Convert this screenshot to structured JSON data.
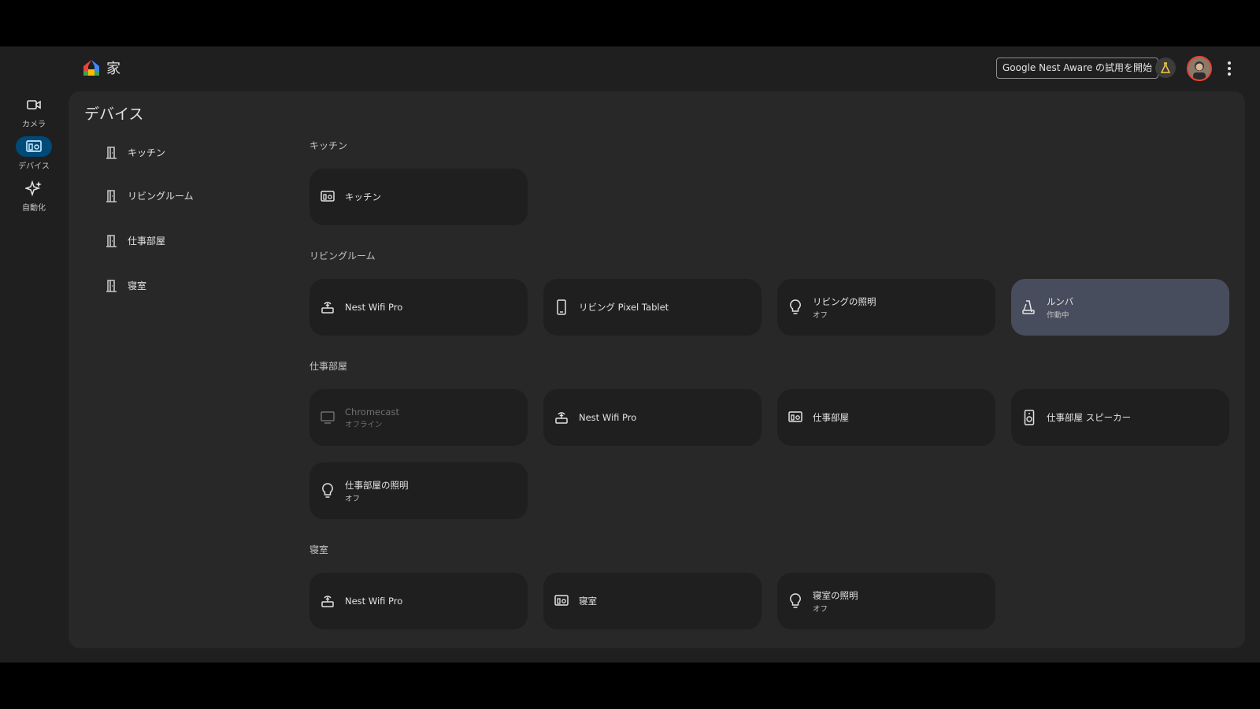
{
  "app": {
    "title": "家"
  },
  "topbar": {
    "nest_aware_label": "Google Nest Aware の試用を開始"
  },
  "rail": [
    {
      "label": "カメラ",
      "icon": "camera-icon"
    },
    {
      "label": "デバイス",
      "icon": "devices-icon",
      "active": true
    },
    {
      "label": "自動化",
      "icon": "automation-sparkle-icon"
    }
  ],
  "page": {
    "title": "デバイス"
  },
  "room_nav": [
    {
      "label": "キッチン"
    },
    {
      "label": "リビングルーム"
    },
    {
      "label": "仕事部屋"
    },
    {
      "label": "寝室"
    }
  ],
  "sections": [
    {
      "heading": "キッチン",
      "tiles": [
        {
          "name": "キッチン",
          "icon": "speaker-group-icon"
        }
      ]
    },
    {
      "heading": "リビングルーム",
      "tiles": [
        {
          "name": "Nest Wifi Pro",
          "icon": "router-icon"
        },
        {
          "name": "リビング Pixel Tablet",
          "icon": "tablet-icon"
        },
        {
          "name": "リビングの照明",
          "status": "オフ",
          "icon": "lightbulb-icon"
        },
        {
          "name": "ルンバ",
          "status": "作動中",
          "icon": "vacuum-icon",
          "active": true
        }
      ]
    },
    {
      "heading": "仕事部屋",
      "tiles": [
        {
          "name": "Chromecast",
          "status": "オフライン",
          "icon": "tv-icon",
          "offline": true
        },
        {
          "name": "Nest Wifi Pro",
          "icon": "router-icon"
        },
        {
          "name": "仕事部屋",
          "icon": "speaker-group-icon"
        },
        {
          "name": "仕事部屋 スピーカー",
          "icon": "speaker-icon"
        },
        {
          "name": "仕事部屋の照明",
          "status": "オフ",
          "icon": "lightbulb-icon"
        }
      ]
    },
    {
      "heading": "寝室",
      "tiles": [
        {
          "name": "Nest Wifi Pro",
          "icon": "router-icon"
        },
        {
          "name": "寝室",
          "icon": "speaker-group-icon"
        },
        {
          "name": "寝室の照明",
          "status": "オフ",
          "icon": "lightbulb-icon"
        }
      ]
    }
  ],
  "colors": {
    "background": "#1f1f1f",
    "panel": "#282828",
    "tile": "#1f1f1f",
    "tile_active": "#474d5c",
    "rail_active": "#004a77"
  }
}
